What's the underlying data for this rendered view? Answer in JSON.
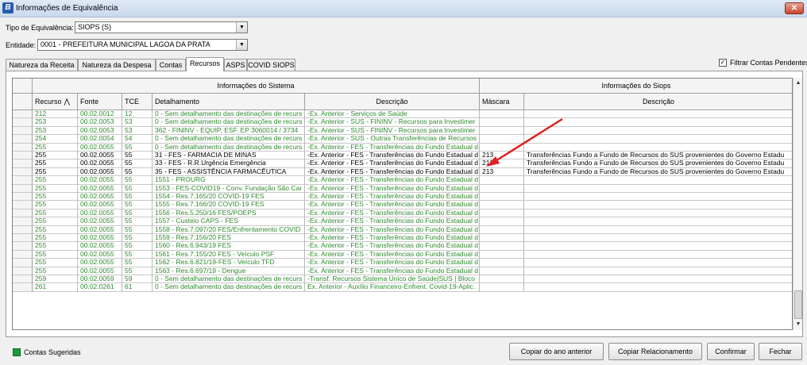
{
  "window": {
    "title": "Informações de Equivalência",
    "app_icon_letter": "B",
    "close_symbol": "✕"
  },
  "form": {
    "tipo_label": "Tipo de Equivalência:",
    "tipo_value": "SIOPS (S)",
    "entidade_label": "Entidade:",
    "entidade_value": "0001 - PREFEITURA MUNICIPAL LAGOA DA PRATA"
  },
  "tabs": [
    {
      "label": "Natureza da Receita",
      "active": false
    },
    {
      "label": "Natureza da Despesa",
      "active": false
    },
    {
      "label": "Contas",
      "active": false
    },
    {
      "label": "Recursos",
      "active": true
    },
    {
      "label": "ASPS",
      "active": false
    },
    {
      "label": "COVID SIOPS",
      "active": false
    }
  ],
  "filter": {
    "label": "Filtrar Contas Pendentes",
    "checked": true,
    "check_mark": "✓"
  },
  "grid": {
    "group_sistema": "Informações do Sistema",
    "group_siops": "Informações do Siops",
    "sort_symbol": "⋀",
    "columns": [
      "Recurso",
      "Fonte",
      "TCE",
      "Detalhamento",
      "Descrição",
      "Máscara",
      "Descrição"
    ],
    "rows": [
      {
        "recurso": "212",
        "fonte": "00.02.0012",
        "tce": "12",
        "detalhamento": "0 - Sem detalhamento das destinações de recurs",
        "descricao": "-Ex. Anterior - Serviços de Saúde",
        "mascara": "",
        "descricao_siops": "",
        "color": "green"
      },
      {
        "recurso": "253",
        "fonte": "00.02.0053",
        "tce": "53",
        "detalhamento": "0 - Sem detalhamento das destinações de recurs",
        "descricao": "-Ex. Anterior - SUS - FININV - Recursos para Investimer",
        "mascara": "",
        "descricao_siops": "",
        "color": "green"
      },
      {
        "recurso": "253",
        "fonte": "00.02.0053",
        "tce": "53",
        "detalhamento": "362 - FININV - EQUIP. ESF. EP 3060014 / 3734",
        "descricao": "-Ex. Anterior - SUS - FININV - Recursos para Investimer",
        "mascara": "",
        "descricao_siops": "",
        "color": "green"
      },
      {
        "recurso": "254",
        "fonte": "00.02.0054",
        "tce": "54",
        "detalhamento": "0 - Sem detalhamento das destinações de recurs",
        "descricao": "-Ex. Anterior - SUS - Outras Transferências de Recursos",
        "mascara": "",
        "descricao_siops": "",
        "color": "green"
      },
      {
        "recurso": "255",
        "fonte": "00.02.0055",
        "tce": "55",
        "detalhamento": "0 - Sem detalhamento das destinações de recurs",
        "descricao": "-Ex. Anterior - FES - Transferências do Fundo Estadual d",
        "mascara": "",
        "descricao_siops": "",
        "color": "green"
      },
      {
        "recurso": "255",
        "fonte": "00.02.0055",
        "tce": "55",
        "detalhamento": "31 - FES - FARMACIA DE MINAS",
        "descricao": "-Ex. Anterior - FES - Transferências do Fundo Estadual d",
        "mascara": "213",
        "descricao_siops": "Transferências Fundo a Fundo de Recursos do SUS provenientes do Governo Estadu",
        "color": "black"
      },
      {
        "recurso": "255",
        "fonte": "00.02.0055",
        "tce": "55",
        "detalhamento": "33 - FES - R.R.Urgência Emergência",
        "descricao": "-Ex. Anterior - FES - Transferências do Fundo Estadual d",
        "mascara": "213",
        "descricao_siops": "Transferências Fundo a Fundo de Recursos do SUS provenientes do Governo Estadu",
        "color": "black"
      },
      {
        "recurso": "255",
        "fonte": "00.02.0055",
        "tce": "55",
        "detalhamento": "35 - FES - ASSISTÊNCIA FARMACÊUTICA",
        "descricao": "-Ex. Anterior - FES - Transferências do Fundo Estadual d",
        "mascara": "213",
        "descricao_siops": "Transferências Fundo a Fundo de Recursos do SUS provenientes do Governo Estadu",
        "color": "black"
      },
      {
        "recurso": "255",
        "fonte": "00.02.0055",
        "tce": "55",
        "detalhamento": "1551 - PROURG",
        "descricao": "-Ex. Anterior - FES - Transferências do Fundo Estadual d",
        "mascara": "",
        "descricao_siops": "",
        "color": "green"
      },
      {
        "recurso": "255",
        "fonte": "00.02.0055",
        "tce": "55",
        "detalhamento": "1553 - FES-COVID19 - Conv. Fundação São Car",
        "descricao": "-Ex. Anterior - FES - Transferências do Fundo Estadual d",
        "mascara": "",
        "descricao_siops": "",
        "color": "green"
      },
      {
        "recurso": "255",
        "fonte": "00.02.0055",
        "tce": "55",
        "detalhamento": "1554 - Res.7.165/20 COVID-19 FES",
        "descricao": "-Ex. Anterior - FES - Transferências do Fundo Estadual d",
        "mascara": "",
        "descricao_siops": "",
        "color": "green"
      },
      {
        "recurso": "255",
        "fonte": "00.02.0055",
        "tce": "55",
        "detalhamento": "1555 - Res.7.166/20 COVID-19 FES",
        "descricao": "-Ex. Anterior - FES - Transferências do Fundo Estadual d",
        "mascara": "",
        "descricao_siops": "",
        "color": "green"
      },
      {
        "recurso": "255",
        "fonte": "00.02.0055",
        "tce": "55",
        "detalhamento": "1556 - Res.5.250/16 FES/POEPS",
        "descricao": "-Ex. Anterior - FES - Transferências do Fundo Estadual d",
        "mascara": "",
        "descricao_siops": "",
        "color": "green"
      },
      {
        "recurso": "255",
        "fonte": "00.02.0055",
        "tce": "55",
        "detalhamento": "1557 - Custeio CAPS - FES",
        "descricao": "-Ex. Anterior - FES - Transferências do Fundo Estadual d",
        "mascara": "",
        "descricao_siops": "",
        "color": "green"
      },
      {
        "recurso": "255",
        "fonte": "00.02.0055",
        "tce": "55",
        "detalhamento": "1558 - Res.7.097/20 FES/Enfrentamento COVID",
        "descricao": "-Ex. Anterior - FES - Transferências do Fundo Estadual d",
        "mascara": "",
        "descricao_siops": "",
        "color": "green"
      },
      {
        "recurso": "255",
        "fonte": "00.02.0055",
        "tce": "55",
        "detalhamento": "1559 - Res.7.156/20 FES",
        "descricao": "-Ex. Anterior - FES - Transferências do Fundo Estadual d",
        "mascara": "",
        "descricao_siops": "",
        "color": "green"
      },
      {
        "recurso": "255",
        "fonte": "00.02.0055",
        "tce": "55",
        "detalhamento": "1560 - Res.6.943/19 FES",
        "descricao": "-Ex. Anterior - FES - Transferências do Fundo Estadual d",
        "mascara": "",
        "descricao_siops": "",
        "color": "green"
      },
      {
        "recurso": "255",
        "fonte": "00.02.0055",
        "tce": "55",
        "detalhamento": "1561 - Res.7.155/20 FES - Veículo PSF",
        "descricao": "-Ex. Anterior - FES - Transferências do Fundo Estadual d",
        "mascara": "",
        "descricao_siops": "",
        "color": "green"
      },
      {
        "recurso": "255",
        "fonte": "00.02.0055",
        "tce": "55",
        "detalhamento": "1562 - Res.6.821/19-FES - Veículo TFD",
        "descricao": "-Ex. Anterior - FES - Transferências do Fundo Estadual d",
        "mascara": "",
        "descricao_siops": "",
        "color": "green"
      },
      {
        "recurso": "255",
        "fonte": "00.02.0055",
        "tce": "55",
        "detalhamento": "1563 - Res.6.697/19 - Dengue",
        "descricao": "-Ex. Anterior - FES - Transferências do Fundo Estadual d",
        "mascara": "",
        "descricao_siops": "",
        "color": "green"
      },
      {
        "recurso": "259",
        "fonte": "00.02.0059",
        "tce": "59",
        "detalhamento": "0 - Sem detalhamento das destinações de recurs",
        "descricao": "-Transf. Recursos Sistema Único de Saúde|SUS | Bloco",
        "mascara": "",
        "descricao_siops": "",
        "color": "green"
      },
      {
        "recurso": "261",
        "fonte": "00.02.0261",
        "tce": "61",
        "detalhamento": "0 - Sem detalhamento das destinações de recurs",
        "descricao": "Ex. Anterior - Auxílio Financeiro-Enfrent. Covid-19-Aplic.",
        "mascara": "",
        "descricao_siops": "",
        "color": "green"
      }
    ]
  },
  "legend": {
    "label": "Contas Sugeridas",
    "color": "#1d9a3a"
  },
  "buttons": {
    "copiar_ano": "Copiar do ano anterior",
    "copiar_rel": "Copiar Relacionamento",
    "confirmar": "Confirmar",
    "fechar": "Fechar"
  },
  "colors": {
    "suggested_text": "#2e8b2e",
    "annotation_arrow": "#e02020"
  },
  "scrollbar": {
    "up_symbol": "▲",
    "down_symbol": "▼"
  }
}
